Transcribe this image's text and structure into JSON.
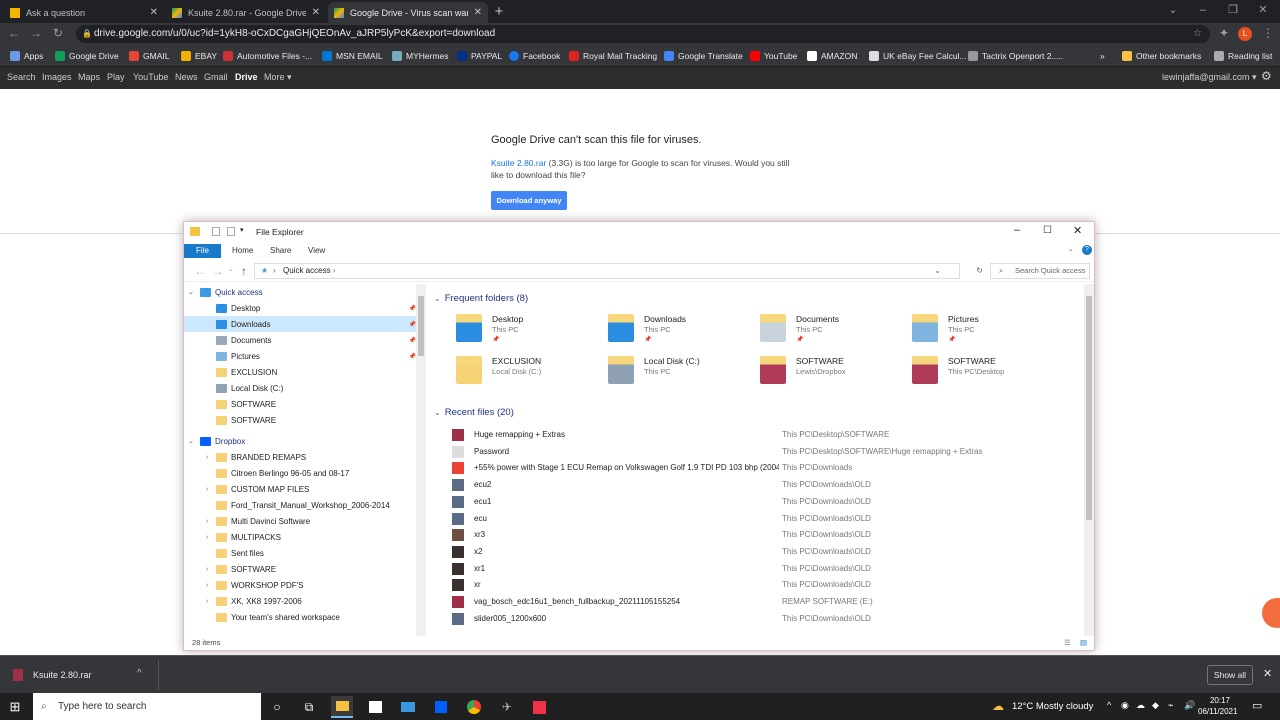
{
  "browser": {
    "tabs": [
      {
        "title": "Ask a question",
        "active": false
      },
      {
        "title": "Ksuite 2.80.rar - Google Drive",
        "active": false
      },
      {
        "title": "Google Drive - Virus scan warnin",
        "active": true
      }
    ],
    "url": "drive.google.com/u/0/uc?id=1ykH8-oCxDCgaGHjQEOnAv_aJRP5lyPcK&export=download",
    "bookmarks": [
      "Apps",
      "Google Drive",
      "GMAIL",
      "EBAY",
      "Automotive Files -...",
      "MSN EMAIL",
      "MYHermes",
      "PAYPAL",
      "Facebook",
      "Royal Mail Tracking",
      "Google Translate",
      "YouTube",
      "AMAZON",
      "UK eBay Fee Calcul...",
      "Tactrix Openport 2....."
    ],
    "other_bookmarks": "Other bookmarks",
    "reading_list": "Reading list",
    "avatar": "L"
  },
  "google_bar": {
    "links": [
      "Search",
      "Images",
      "Maps",
      "Play",
      "YouTube",
      "News",
      "Gmail",
      "Drive",
      "More ▾"
    ],
    "selected": "Drive",
    "account": "lewinjaffa@gmail.com ▾"
  },
  "drive_page": {
    "title": "Google Drive can't scan this file for viruses.",
    "file_link": "Ksuite 2.80.rar",
    "message": " (3.3G) is too large for Google to scan for viruses. Would you still like to download this file?",
    "button": "Download anyway"
  },
  "explorer": {
    "title": "File Explorer",
    "ribbon": [
      "File",
      "Home",
      "Share",
      "View"
    ],
    "path": "Quick access",
    "search_placeholder": "Search Quick access",
    "status": "28 items",
    "nav": [
      {
        "label": "Quick access",
        "level": 0,
        "arrow": "⌄",
        "icon": "#3a9be8"
      },
      {
        "label": "Desktop",
        "level": 1,
        "pin": true,
        "icon": "#2b8ee0"
      },
      {
        "label": "Downloads",
        "level": 1,
        "pin": true,
        "selected": true,
        "icon": "#2b8ee0"
      },
      {
        "label": "Documents",
        "level": 1,
        "pin": true,
        "icon": "#9aa7b5"
      },
      {
        "label": "Pictures",
        "level": 1,
        "pin": true,
        "icon": "#7fb3e0"
      },
      {
        "label": "EXCLUSION",
        "level": 1,
        "icon": "#f5d274"
      },
      {
        "label": "Local Disk (C:)",
        "level": 1,
        "icon": "#8fa2b5"
      },
      {
        "label": "SOFTWARE",
        "level": 1,
        "icon": "#f5d274"
      },
      {
        "label": "SOFTWARE",
        "level": 1,
        "icon": "#f5d274"
      },
      {
        "label": "Dropbox",
        "level": 0,
        "arrow": "⌄",
        "icon": "#0061fe"
      },
      {
        "label": "BRANDED REMAPS",
        "level": 1,
        "arrow": "›",
        "icon": "#f5d274"
      },
      {
        "label": "Citroen Berlingo 96-05 and 08-17",
        "level": 1,
        "icon": "#f5d274"
      },
      {
        "label": "CUSTOM MAP FILES",
        "level": 1,
        "arrow": "›",
        "icon": "#f5d274"
      },
      {
        "label": "Ford_Transit_Manual_Workshop_2006-2014",
        "level": 1,
        "icon": "#f5d274"
      },
      {
        "label": "Multi Davinci Software",
        "level": 1,
        "arrow": "›",
        "icon": "#f5d274"
      },
      {
        "label": "MULTIPACKS",
        "level": 1,
        "arrow": "›",
        "icon": "#f5d274"
      },
      {
        "label": "Sent files",
        "level": 1,
        "icon": "#f5d274"
      },
      {
        "label": "SOFTWARE",
        "level": 1,
        "arrow": "›",
        "icon": "#f5d274"
      },
      {
        "label": "WORKSHOP PDF'S",
        "level": 1,
        "arrow": "›",
        "icon": "#f5d274"
      },
      {
        "label": "XK, XK8 1997-2006",
        "level": 1,
        "arrow": "›",
        "icon": "#f5d274"
      },
      {
        "label": "Your team's shared workspace",
        "level": 1,
        "icon": "#f5d274"
      }
    ],
    "frequent_header": "Frequent folders (8)",
    "frequent": [
      {
        "name": "Desktop",
        "sub": "This PC",
        "pin": true,
        "color": "#2b8ee0"
      },
      {
        "name": "Downloads",
        "sub": "This PC",
        "pin": true,
        "color": "#2b8ee0"
      },
      {
        "name": "Documents",
        "sub": "This PC",
        "pin": true,
        "color": "#c9d3dd"
      },
      {
        "name": "Pictures",
        "sub": "This PC",
        "pin": true,
        "color": "#7fb3e0"
      },
      {
        "name": "EXCLUSION",
        "sub": "Local Disk (C:)",
        "color": "#f5d274"
      },
      {
        "name": "Local Disk (C:)",
        "sub": "This PC",
        "color": "#8fa2b5"
      },
      {
        "name": "SOFTWARE",
        "sub": "Lewis\\Dropbox",
        "color": "#b03a5a"
      },
      {
        "name": "SOFTWARE",
        "sub": "This PC\\Desktop",
        "color": "#b03a5a"
      }
    ],
    "recent_header": "Recent files (20)",
    "recent": [
      {
        "name": "Huge remapping + Extras",
        "path": "This PC\\Desktop\\SOFTWARE",
        "color": "#a0304a"
      },
      {
        "name": "Password",
        "path": "This PC\\Desktop\\SOFTWARE\\Huge remapping + Extras",
        "color": "#ddd"
      },
      {
        "name": "+55% power with Stage 1 ECU Remap on Volkswagen Golf 1.9 TDI PD 103 bhp (2004...",
        "path": "This PC\\Downloads",
        "color": "#ea4335"
      },
      {
        "name": "ecu2",
        "path": "This PC\\Downloads\\OLD",
        "color": "#5a6b85"
      },
      {
        "name": "ecu1",
        "path": "This PC\\Downloads\\OLD",
        "color": "#5a6b85"
      },
      {
        "name": "ecu",
        "path": "This PC\\Downloads\\OLD",
        "color": "#5a6b85"
      },
      {
        "name": "xr3",
        "path": "This PC\\Downloads\\OLD",
        "color": "#6b5040"
      },
      {
        "name": "x2",
        "path": "This PC\\Downloads\\OLD",
        "color": "#3a3030"
      },
      {
        "name": "xr1",
        "path": "This PC\\Downloads\\OLD",
        "color": "#3a3030"
      },
      {
        "name": "xr",
        "path": "This PC\\Downloads\\OLD",
        "color": "#3a3030"
      },
      {
        "name": "vag_bosch_edc16u1_bench_fullbackup_20211105155254",
        "path": "REMAP SOFTWARE (E:)",
        "color": "#a0304a"
      },
      {
        "name": "slider005_1200x600",
        "path": "This PC\\Downloads\\OLD",
        "color": "#5a6b85"
      }
    ]
  },
  "download_shelf": {
    "file": "Ksuite 2.80.rar",
    "show_all": "Show all"
  },
  "taskbar": {
    "search": "Type here to search",
    "weather": "12°C  Mostly cloudy",
    "time": "20:17",
    "date": "06/11/2021"
  }
}
